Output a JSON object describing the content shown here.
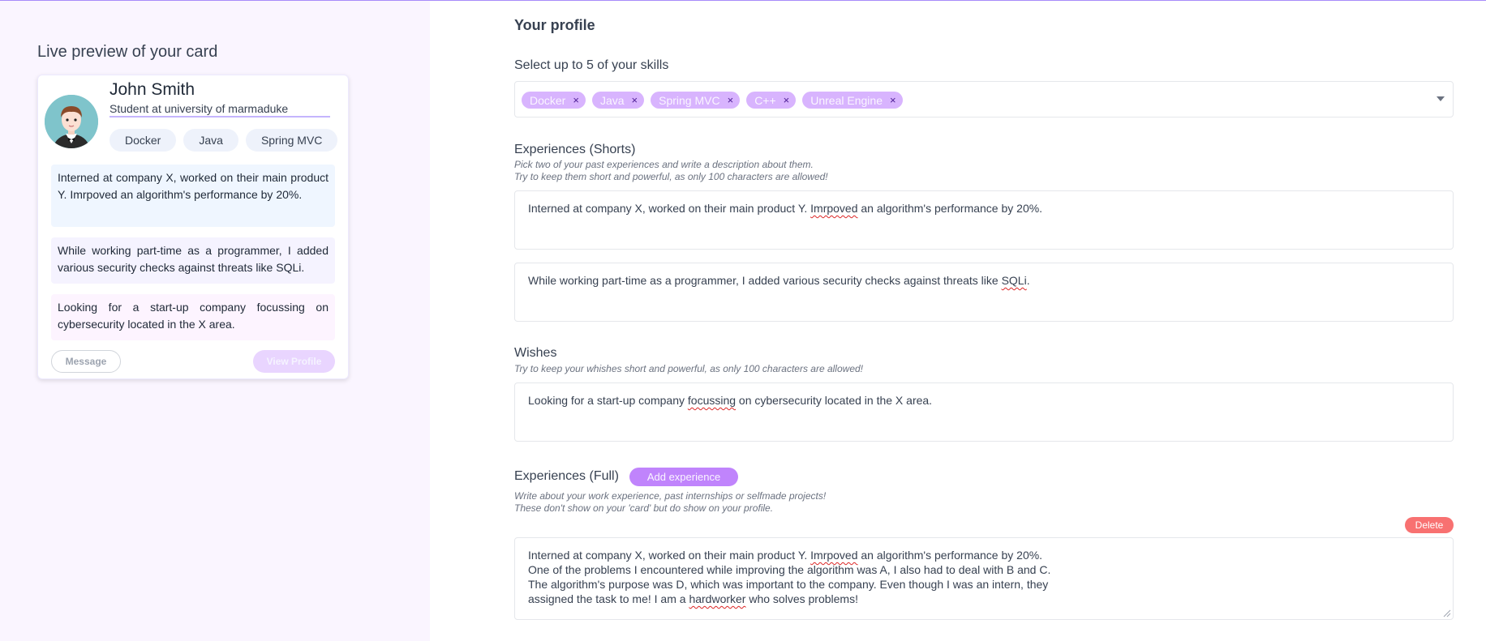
{
  "preview": {
    "title": "Live preview of your card",
    "card": {
      "name": "John Smith",
      "tagline": "Student at university of marmaduke",
      "skills": [
        "Docker",
        "Java",
        "Spring MVC"
      ],
      "experience_1": "Interned at company X, worked on their main product Y. Imrpoved an algorithm's performance by 20%.",
      "experience_2": "While working part-time as a programmer, I added various security checks against threats like SQLi.",
      "wish": "Looking for a start-up company focussing on cybersecurity located in the X area.",
      "message_label": "Message",
      "view_profile_label": "View Profile"
    }
  },
  "form": {
    "title": "Your profile",
    "skills": {
      "label": "Select up to 5 of your skills",
      "selected": [
        "Docker",
        "Java",
        "Spring MVC",
        "C++",
        "Unreal Engine"
      ],
      "remove_glyph": "×"
    },
    "shorts": {
      "label": "Experiences (Shorts)",
      "hint_1": "Pick two of your past experiences and write a description about them.",
      "hint_2": "Try to keep them short and powerful, as only 100 characters are allowed!",
      "exp_1": {
        "a": "Interned at company X, worked on their main product Y. ",
        "b": "Imrpoved",
        "c": " an algorithm's performance by 20%."
      },
      "exp_2": {
        "a": "While working part-time as a programmer, I added various security checks against threats like ",
        "b": "SQLi",
        "c": "."
      }
    },
    "wishes": {
      "label": "Wishes",
      "hint": "Try to keep your whishes short and powerful, as only 100 characters are allowed!",
      "value": {
        "a": "Looking for a start-up company ",
        "b": "focussing",
        "c": " on cybersecurity located in the X area."
      }
    },
    "full": {
      "label": "Experiences (Full)",
      "add_label": "Add experience",
      "hint_1": "Write about your work experience, past internships or selfmade projects!",
      "hint_2": "These don't show on your 'card' but do show on your profile.",
      "delete_label": "Delete",
      "entry": {
        "l1a": "Interned at company X, worked on their main product Y. ",
        "l1b": "Imrpoved",
        "l1c": " an algorithm's performance by 20%.",
        "l2": "One of the problems I encountered while improving the algorithm was A, I also had to deal with B and C.",
        "l3": "The algorithm's purpose was D, which was important to the company. Even though I was an intern, they",
        "l4a": "assigned the task to me! I am a ",
        "l4b": "hardworker",
        "l4c": " who solves problems!"
      }
    }
  },
  "colors": {
    "accent": "#c084fc",
    "left_panel_bg": "#faf5ff",
    "delete": "#f87171"
  }
}
